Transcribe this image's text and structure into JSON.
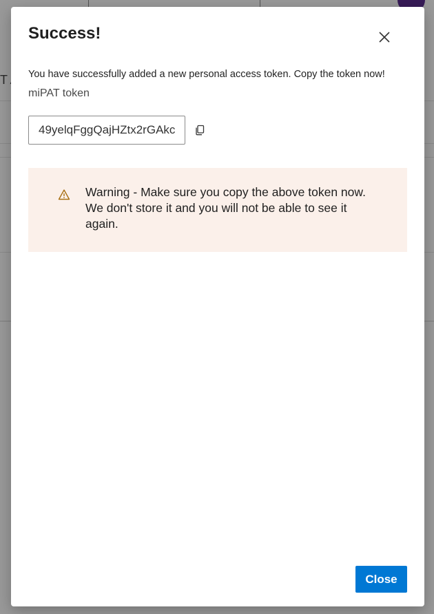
{
  "dialog": {
    "title": "Success!",
    "message": "You have successfully added a new personal access token. Copy the token now!",
    "token_name": "miPAT token",
    "token_value": "49yelqFggQajHZtx2rGAkc",
    "warning_text": "Warning - Make sure you copy the above token now. We don't store it and you will not be able to see it again.",
    "close_button_label": "Close"
  },
  "background": {
    "partial_text": "T A"
  },
  "icons": {
    "close": "close-icon",
    "copy": "copy-icon",
    "warning": "warning-icon"
  },
  "colors": {
    "primary": "#0078d4",
    "warning_bg": "#fbf0ea",
    "warning_icon": "#a86f12"
  }
}
